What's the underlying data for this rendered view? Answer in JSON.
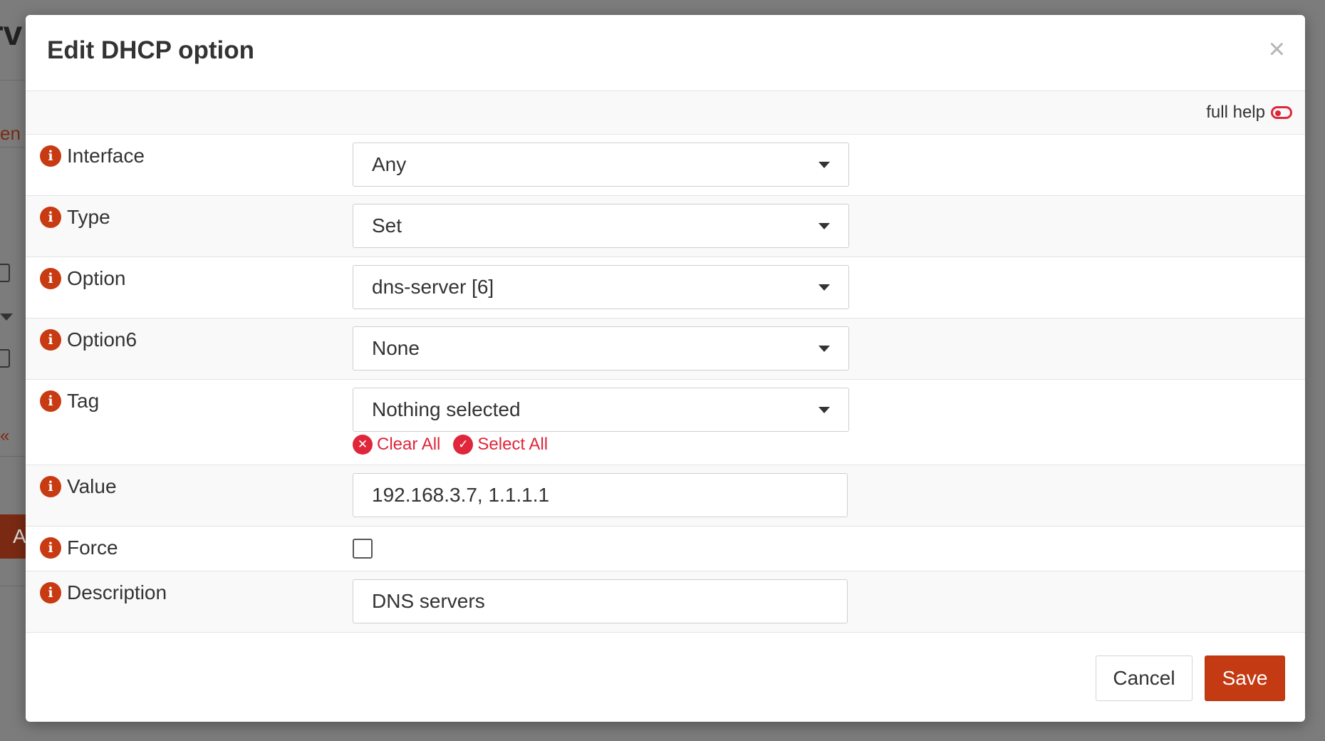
{
  "background": {
    "title_fragment": "rv",
    "tab_fragment": "en",
    "prev_fragment": "«",
    "button_fragment": "A"
  },
  "modal": {
    "title": "Edit DHCP option",
    "close_glyph": "×",
    "full_help_label": "full help",
    "fields": {
      "interface": {
        "label": "Interface",
        "value": "Any"
      },
      "type": {
        "label": "Type",
        "value": "Set"
      },
      "option": {
        "label": "Option",
        "value": "dns-server [6]"
      },
      "option6": {
        "label": "Option6",
        "value": "None"
      },
      "tag": {
        "label": "Tag",
        "value": "Nothing selected",
        "clear_all": "Clear All",
        "select_all": "Select All"
      },
      "value": {
        "label": "Value",
        "value": "192.168.3.7, 1.1.1.1"
      },
      "force": {
        "label": "Force",
        "checked": false
      },
      "description": {
        "label": "Description",
        "value": "DNS servers"
      }
    },
    "info_glyph": "i",
    "clear_glyph": "✕",
    "select_glyph": "✓",
    "buttons": {
      "cancel": "Cancel",
      "save": "Save"
    }
  },
  "colors": {
    "accent": "#c33a13",
    "danger": "#e0263a",
    "overlay": "#7c7c7c"
  }
}
